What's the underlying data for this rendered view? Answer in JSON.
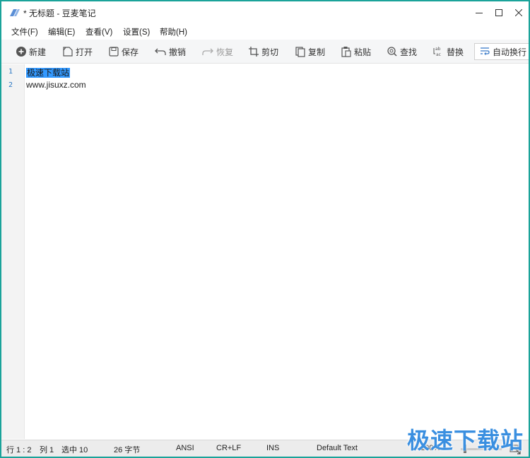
{
  "window": {
    "title": "* 无标题 - 豆麦笔记"
  },
  "menu": [
    {
      "label": "文件(F)"
    },
    {
      "label": "编辑(E)"
    },
    {
      "label": "查看(V)"
    },
    {
      "label": "设置(S)"
    },
    {
      "label": "帮助(H)"
    }
  ],
  "toolbar": {
    "new_label": "新建",
    "open_label": "打开",
    "save_label": "保存",
    "undo_label": "撤销",
    "redo_label": "恢复",
    "cut_label": "剪切",
    "copy_label": "复制",
    "paste_label": "粘贴",
    "find_label": "查找",
    "replace_label": "替换",
    "wrap_label": "自动换行"
  },
  "editor": {
    "lines": [
      {
        "number": "1",
        "text": "极速下载站",
        "selected": true
      },
      {
        "number": "2",
        "text": "www.jisuxz.com",
        "selected": false
      }
    ]
  },
  "status": {
    "row": "行 1 : 2",
    "col": "列 1",
    "selection": "选中 10",
    "bytes": "26 字节",
    "encoding": "ANSI",
    "line_ending": "CR+LF",
    "insert_mode": "INS",
    "syntax": "Default Text",
    "zoom": "100%"
  },
  "watermark": {
    "text": "极速下载站"
  },
  "colors": {
    "window_border": "#1aa39a",
    "selection": "#3399ff",
    "line_number": "#2b78c4",
    "watermark": "#3a8fe0"
  }
}
